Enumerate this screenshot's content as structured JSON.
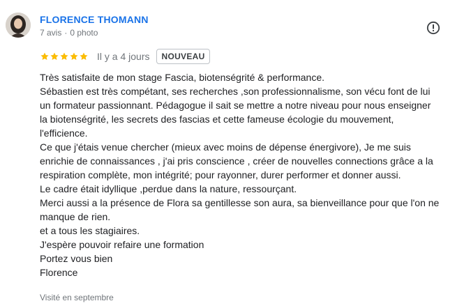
{
  "reviewer": {
    "name": "FLORENCE THOMANN",
    "reviews_count": "7 avis",
    "photos_count": "0 photo"
  },
  "icons": {
    "report": "report-flag-icon",
    "star": "star-icon"
  },
  "colors": {
    "name": "#1a73e8",
    "star": "#fbbc04",
    "muted": "#70757a",
    "text": "#202124"
  },
  "rating": {
    "stars": 5,
    "max": 5,
    "date": "Il y a 4 jours",
    "badge": "NOUVEAU"
  },
  "review": {
    "lines": [
      "Très satisfaite de mon stage Fascia, biotenségrité & performance.",
      "Sébastien est très compétant, ses recherches ,son professionnalisme, son vécu font de lui",
      "un formateur passionnant. Pédagogue il sait se mettre a notre niveau pour nous enseigner",
      "la biotenségrité, les secrets des fascias et cette fameuse écologie du mouvement,",
      "l'efficience.",
      "Ce que j'étais venue chercher (mieux avec moins de dépense énergivore), Je me suis",
      "enrichie de connaissances , j'ai pris conscience , créer de nouvelles connections grâce a la",
      "respiration complète, mon intégrité; pour rayonner, durer performer et donner aussi.",
      "Le cadre était idyllique ,perdue dans la nature, ressourçant.",
      "Merci aussi a la présence de Flora sa gentillesse son aura, sa bienveillance pour que l'on ne",
      "manque de rien.",
      "et a tous les stagiaires.",
      "J'espère pouvoir refaire une formation",
      "Portez vous bien",
      "Florence"
    ]
  },
  "footer": {
    "visited": "Visité en septembre"
  }
}
